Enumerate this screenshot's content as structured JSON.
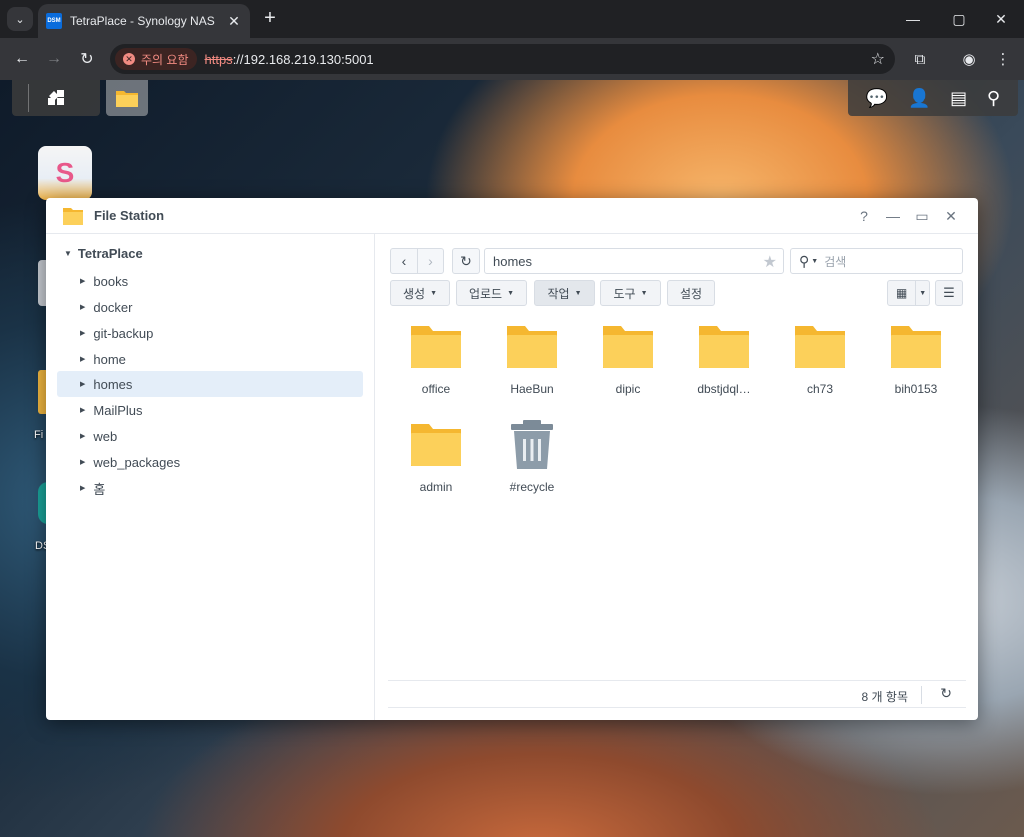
{
  "browser": {
    "tab_title": "TetraPlace - Synology NAS",
    "favicon_text": "DSM",
    "security_label": "주의 요함",
    "url_scheme": "https",
    "url_rest": "://192.168.219.130:5001"
  },
  "dsm": {
    "taskbar_left_icon": "main-menu-icon",
    "taskbar_right_icons": [
      "chat-icon",
      "user-icon",
      "widgets-icon",
      "search-icon"
    ],
    "desktop_labels": {
      "file": "Fi",
      "ds": "DS"
    }
  },
  "file_station": {
    "title": "File Station",
    "window_buttons": {
      "help": "?",
      "minimize": "—",
      "maximize": "▭",
      "close": "✕"
    },
    "tree": {
      "root": "TetraPlace",
      "items": [
        "books",
        "docker",
        "git-backup",
        "home",
        "homes",
        "MailPlus",
        "web",
        "web_packages",
        "홈"
      ],
      "selected": "homes"
    },
    "path": "homes",
    "search_placeholder": "검색",
    "actions": {
      "create": "생성",
      "upload": "업로드",
      "action": "작업",
      "tools": "도구",
      "settings": "설정"
    },
    "files": [
      {
        "name": "office",
        "type": "folder"
      },
      {
        "name": "HaeBun",
        "type": "folder"
      },
      {
        "name": "dipic",
        "type": "folder"
      },
      {
        "name": "dbstjdql…",
        "type": "folder"
      },
      {
        "name": "ch73",
        "type": "folder"
      },
      {
        "name": "bih0153",
        "type": "folder"
      },
      {
        "name": "admin",
        "type": "folder"
      },
      {
        "name": "#recycle",
        "type": "recycle-bin"
      }
    ],
    "status": {
      "item_count": "8 개 항목"
    }
  },
  "colors": {
    "folder": "#f5b730",
    "folder_front": "#fcd05a",
    "selected_bg": "#e4eef9",
    "text": "#414b55",
    "warning": "#f28b82"
  }
}
